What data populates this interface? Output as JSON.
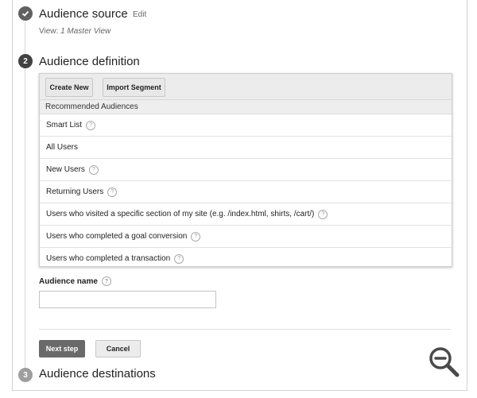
{
  "steps": {
    "source": {
      "title": "Audience source",
      "edit_label": "Edit",
      "view_prefix": "View:",
      "view_value": "1 Master View"
    },
    "definition": {
      "number": "2",
      "title": "Audience definition",
      "toolbar": {
        "create_label": "Create New",
        "import_label": "Import Segment"
      },
      "section_header": "Recommended Audiences",
      "items": [
        {
          "label": "Smart List",
          "help": true
        },
        {
          "label": "All Users",
          "help": false
        },
        {
          "label": "New Users",
          "help": true
        },
        {
          "label": "Returning Users",
          "help": true
        },
        {
          "label": "Users who visited a specific section of my site (e.g. /index.html, shirts, /cart/)",
          "help": true
        },
        {
          "label": "Users who completed a goal conversion",
          "help": true
        },
        {
          "label": "Users who completed a transaction",
          "help": true
        }
      ]
    },
    "destinations": {
      "number": "3",
      "title": "Audience destinations"
    }
  },
  "audience_name": {
    "label": "Audience name",
    "value": "",
    "placeholder": ""
  },
  "actions": {
    "next_label": "Next step",
    "cancel_label": "Cancel"
  },
  "icons": {
    "completed": "checkmark-icon",
    "help": "question-mark-icon",
    "zoom": "zoom-out-icon"
  },
  "help_glyph": "?"
}
